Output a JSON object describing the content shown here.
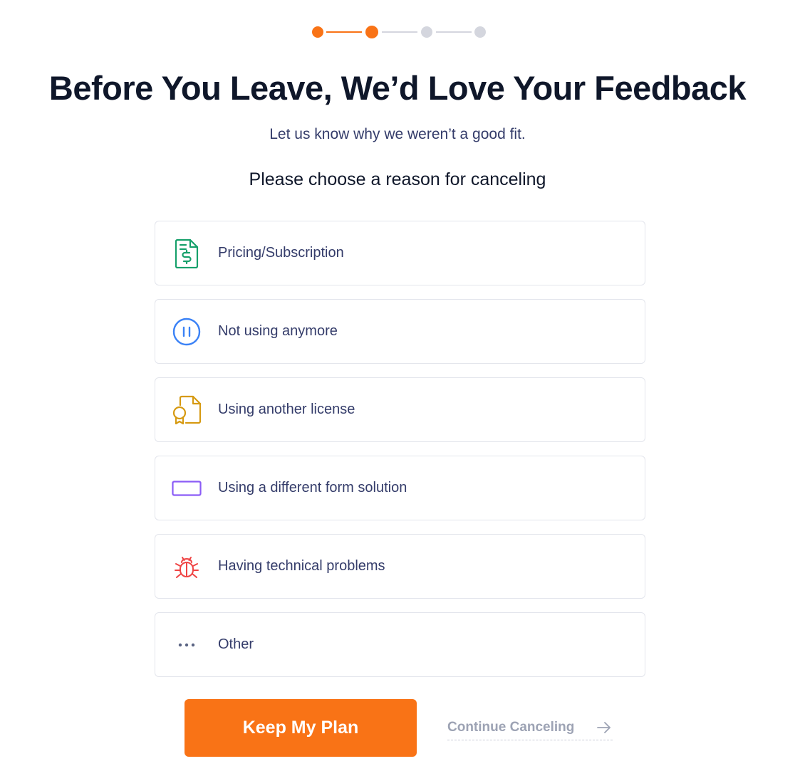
{
  "stepper": {
    "current_step": 2,
    "total_steps": 4,
    "active_color": "#f97316",
    "inactive_color": "#d4d6de"
  },
  "header": {
    "title": "Before You Leave, We’d Love Your Feedback",
    "subtitle": "Let us know why we weren’t a good fit.",
    "prompt": "Please choose a reason for canceling"
  },
  "options": [
    {
      "label": "Pricing/Subscription",
      "icon": "invoice-dollar-icon",
      "color": "#16a06b"
    },
    {
      "label": "Not using anymore",
      "icon": "pause-circle-icon",
      "color": "#3b82f6"
    },
    {
      "label": "Using another license",
      "icon": "certificate-document-icon",
      "color": "#d69a12"
    },
    {
      "label": "Using a different form solution",
      "icon": "rectangle-field-icon",
      "color": "#8b5cf6"
    },
    {
      "label": "Having technical problems",
      "icon": "bug-icon",
      "color": "#ef4444"
    },
    {
      "label": "Other",
      "icon": "more-dots-icon",
      "color": "#5b6584"
    }
  ],
  "actions": {
    "keep_label": "Keep My Plan",
    "continue_label": "Continue Canceling",
    "primary_color": "#f97316"
  }
}
